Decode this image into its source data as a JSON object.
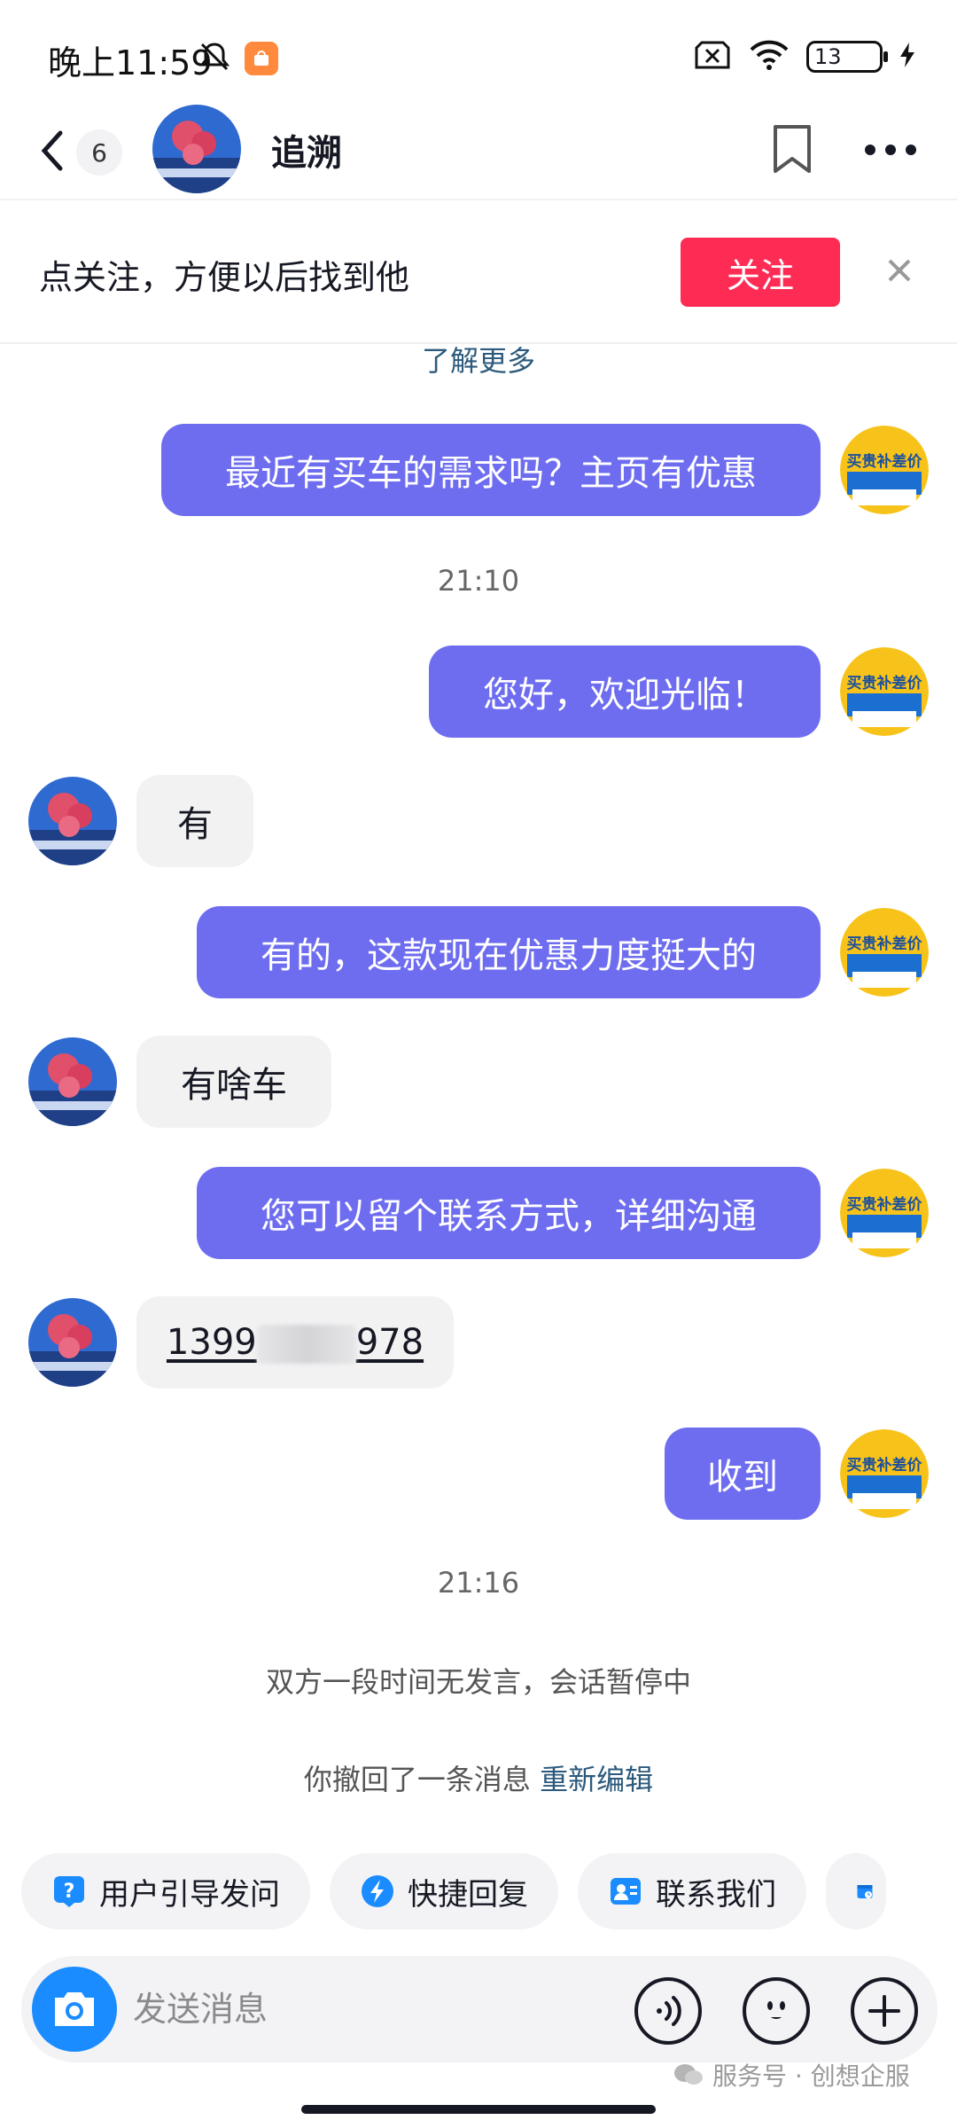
{
  "status_bar": {
    "time": "晚上11:59",
    "battery": "13"
  },
  "header": {
    "back_count": "6",
    "contact_name": "追溯"
  },
  "follow_banner": {
    "text": "点关注，方便以后找到他",
    "follow_label": "关注"
  },
  "learn_more": "了解更多",
  "messages": [
    {
      "side": "self",
      "text": "最近有买车的需求吗？主页有优惠"
    },
    {
      "side": "timestamp",
      "text": "21:10"
    },
    {
      "side": "self",
      "text": "您好，欢迎光临！"
    },
    {
      "side": "peer",
      "text": "有"
    },
    {
      "side": "self",
      "text": "有的，这款现在优惠力度挺大的"
    },
    {
      "side": "peer",
      "text": "有啥车"
    },
    {
      "side": "self",
      "text": "您可以留个联系方式，详细沟通"
    },
    {
      "side": "peer",
      "phone_prefix": "1399",
      "phone_suffix": "978"
    },
    {
      "side": "self",
      "text": "收到"
    },
    {
      "side": "timestamp",
      "text": "21:16"
    }
  ],
  "system_notes": {
    "paused": "双方一段时间无发言，会话暂停中",
    "recalled": "你撤回了一条消息",
    "re_edit": "重新编辑"
  },
  "quick_actions": [
    {
      "label": "用户引导发问",
      "icon": "question-icon"
    },
    {
      "label": "快捷回复",
      "icon": "lightning-icon"
    },
    {
      "label": "联系我们",
      "icon": "contact-card-icon"
    }
  ],
  "input": {
    "placeholder": "发送消息"
  },
  "watermark": "服务号 · 创想企服",
  "self_avatar_text": "买贵补差价",
  "colors": {
    "self_bubble": "#6e6df0",
    "follow_button": "#fe2c55",
    "camera_button": "#1a8cff",
    "link": "#2c5a7c"
  }
}
